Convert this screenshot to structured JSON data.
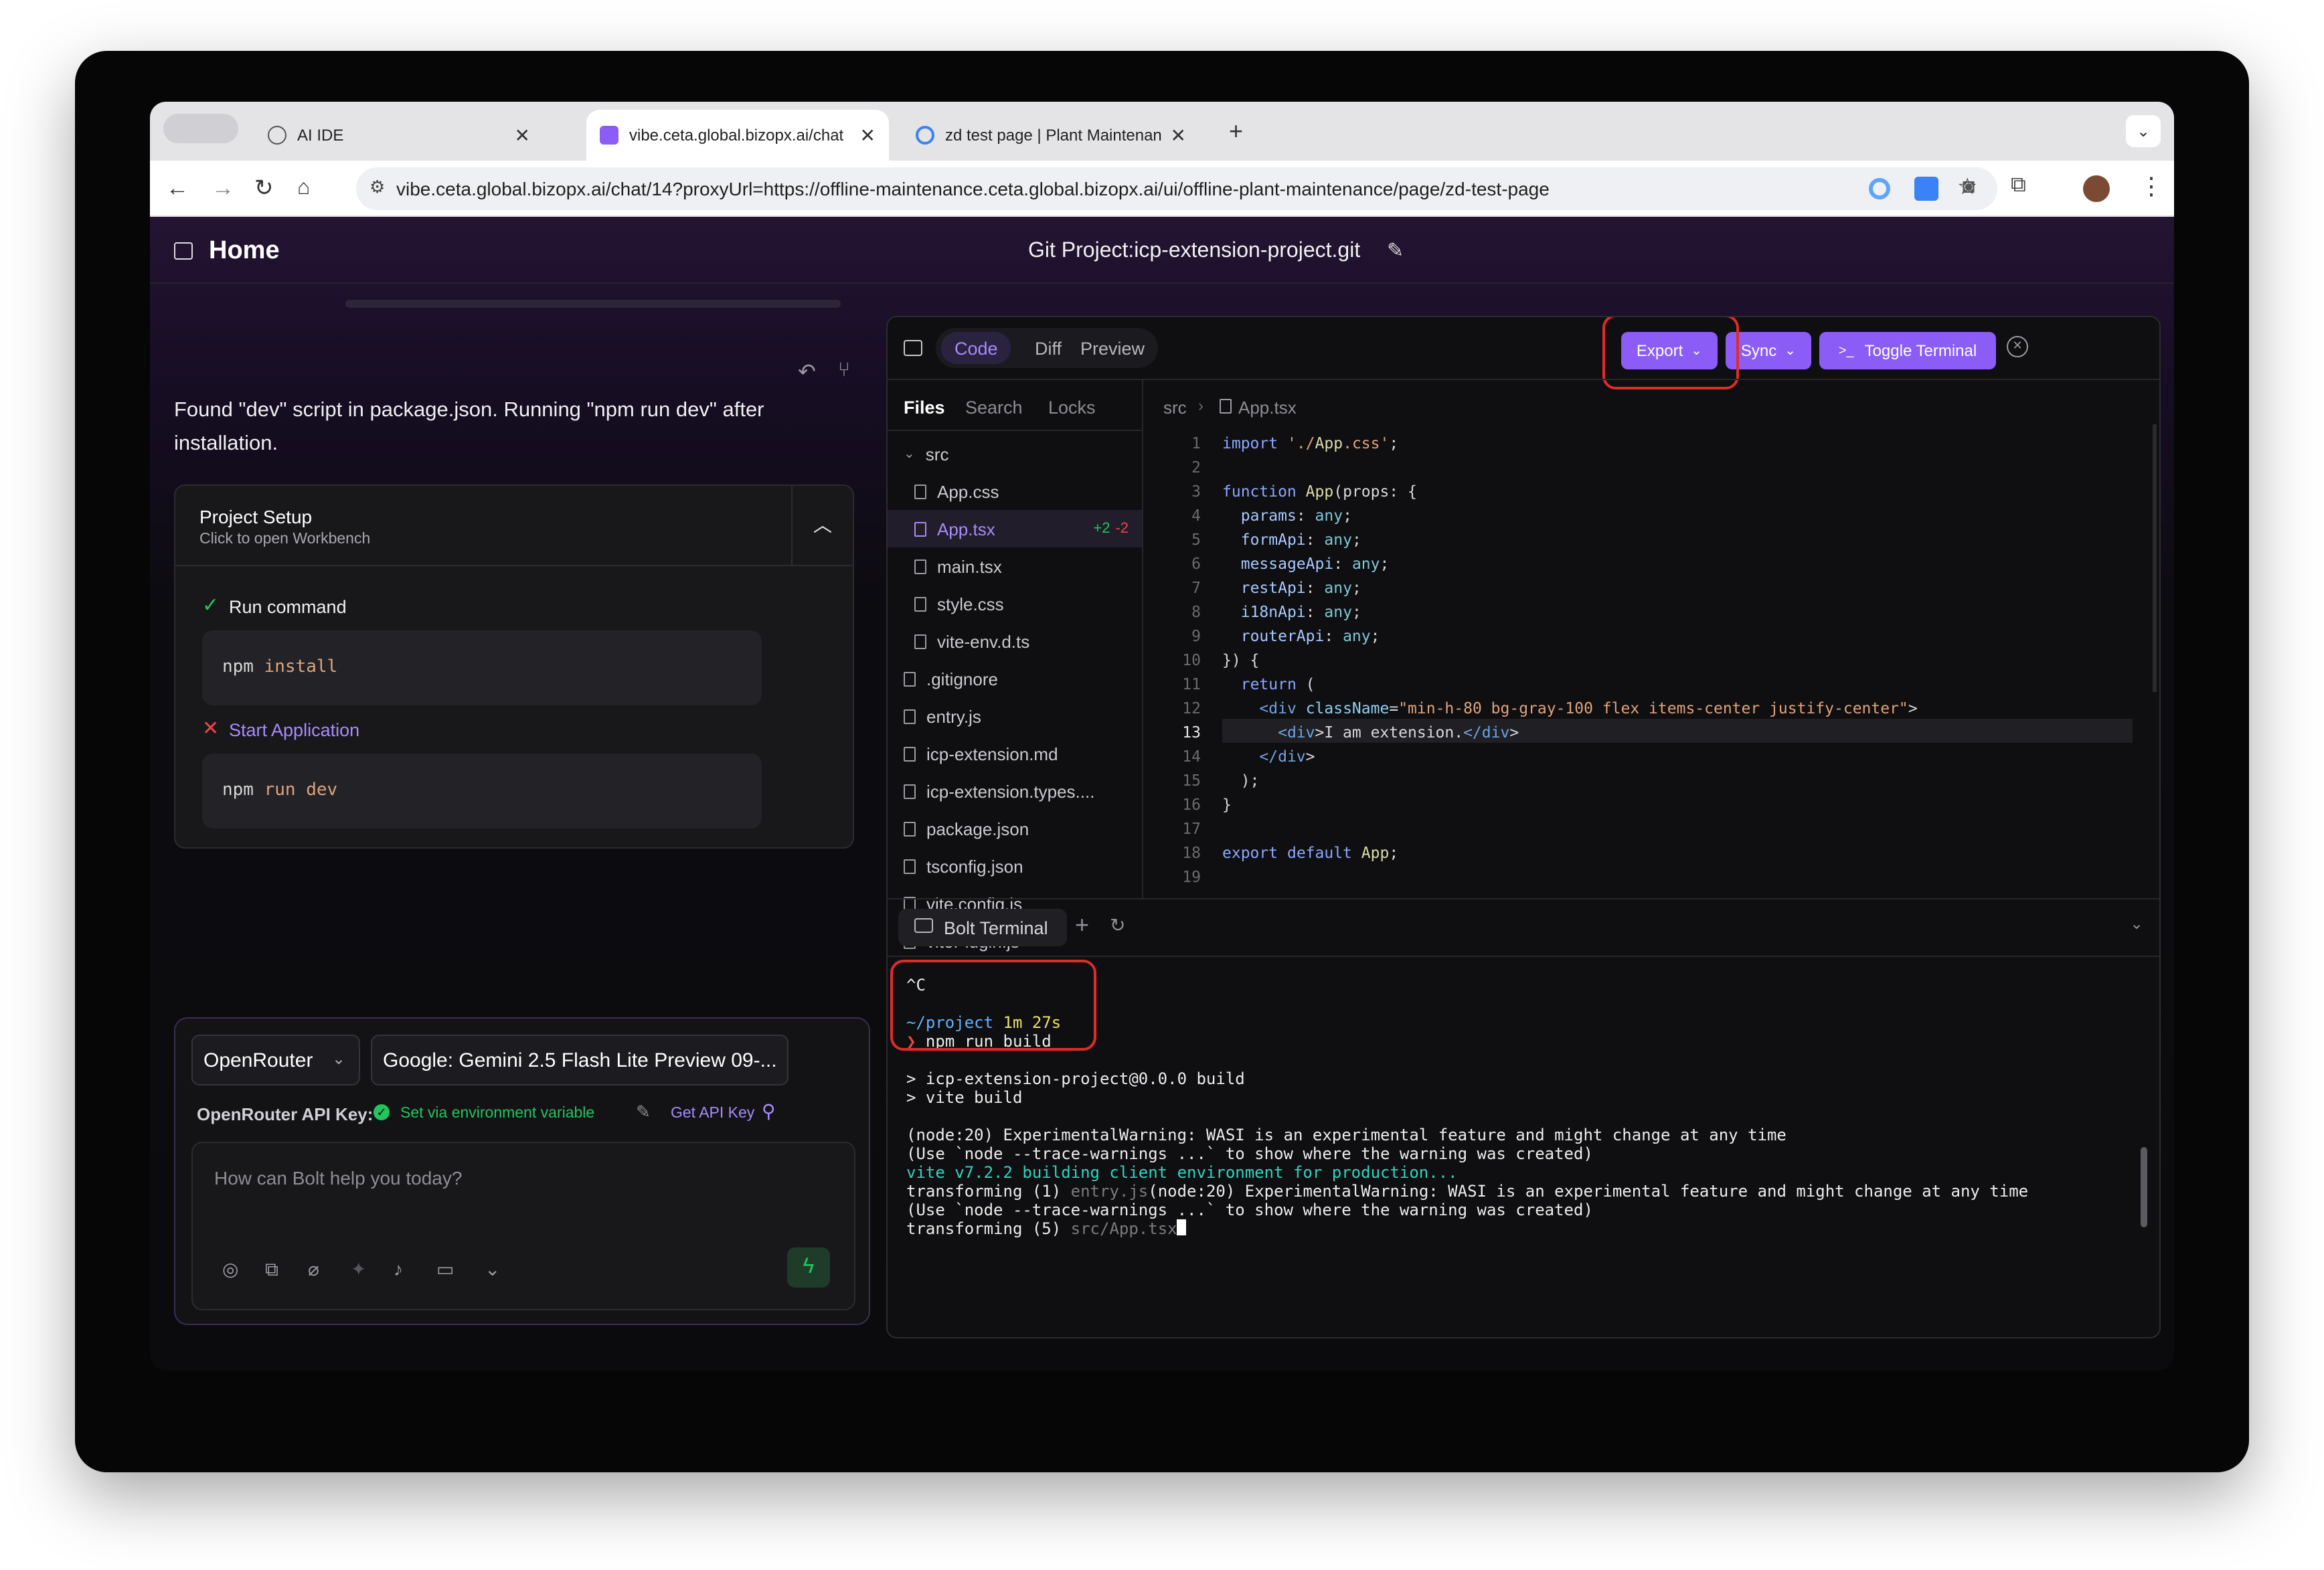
{
  "browser": {
    "tabs": [
      {
        "title": "AI IDE"
      },
      {
        "title": "vibe.ceta.global.bizopx.ai/chat"
      },
      {
        "title": "zd test page | Plant Maintenance"
      }
    ],
    "url": "vibe.ceta.global.bizopx.ai/chat/14?proxyUrl=https://offline-maintenance.ceta.global.bizopx.ai/ui/offline-plant-maintenance/page/zd-test-page"
  },
  "header": {
    "home_label": "Home",
    "project_title": "Git Project:icp-extension-project.git"
  },
  "chat": {
    "message": "Found \"dev\" script in package.json. Running \"npm run dev\" after installation.",
    "setup": {
      "title": "Project Setup",
      "subtitle": "Click to open Workbench",
      "steps": [
        {
          "label": "Run command",
          "command_tool": "npm",
          "command_args": "install",
          "status": "done"
        },
        {
          "label": "Start Application",
          "command_tool": "npm",
          "command_args": "run dev",
          "status": "failed"
        }
      ]
    },
    "provider": "OpenRouter",
    "model": "Google: Gemini 2.5 Flash Lite Preview 09-...",
    "api_key_label": "OpenRouter API Key:",
    "api_key_status": "Set via environment variable",
    "get_api_key": "Get API Key",
    "input_placeholder": "How can Bolt help you today?"
  },
  "workbench": {
    "tabs": [
      "Code",
      "Diff",
      "Preview"
    ],
    "active_tab": "Code",
    "export_label": "Export",
    "sync_label": "Sync",
    "toggle_terminal_label": "Toggle Terminal",
    "file_tabs": [
      "Files",
      "Search",
      "Locks"
    ],
    "breadcrumb": [
      "src",
      "App.tsx"
    ],
    "files": [
      {
        "name": "src",
        "type": "folder"
      },
      {
        "name": "App.css"
      },
      {
        "name": "App.tsx",
        "active": true,
        "added": "+2",
        "removed": "-2"
      },
      {
        "name": "main.tsx"
      },
      {
        "name": "style.css"
      },
      {
        "name": "vite-env.d.ts"
      },
      {
        "name": ".gitignore"
      },
      {
        "name": "entry.js"
      },
      {
        "name": "icp-extension.md"
      },
      {
        "name": "icp-extension.types...."
      },
      {
        "name": "package.json"
      },
      {
        "name": "tsconfig.json"
      },
      {
        "name": "vite.config.js"
      },
      {
        "name": "vitePlugin.js"
      }
    ],
    "code_lines": [
      "import './App.css';",
      "",
      "function App(props: {",
      "  params: any;",
      "  formApi: any;",
      "  messageApi: any;",
      "  restApi: any;",
      "  i18nApi: any;",
      "  routerApi: any;",
      "}) {",
      "  return (",
      "    <div className=\"min-h-80 bg-gray-100 flex items-center justify-center\">",
      "      <div>I am extension.</div>",
      "    </div>",
      "  );",
      "}",
      "",
      "export default App;",
      ""
    ],
    "active_line": 13,
    "terminal_tab": "Bolt Terminal",
    "terminal_lines": [
      "^C",
      "",
      "~/project 1m 27s",
      "❯ npm run build",
      "",
      "> icp-extension-project@0.0.0 build",
      "> vite build",
      "",
      "(node:20) ExperimentalWarning: WASI is an experimental feature and might change at any time",
      "(Use `node --trace-warnings ...` to show where the warning was created)",
      "vite v7.2.2 building client environment for production...",
      "transforming (1) entry.js(node:20) ExperimentalWarning: WASI is an experimental feature and might change at any time",
      "(Use `node --trace-warnings ...` to show where the warning was created)",
      "transforming (5) src/App.tsx"
    ]
  },
  "colors": {
    "accent": "#8b5cf6",
    "success": "#22c55e",
    "error": "#ef4444",
    "highlight": "#e12a2a"
  }
}
